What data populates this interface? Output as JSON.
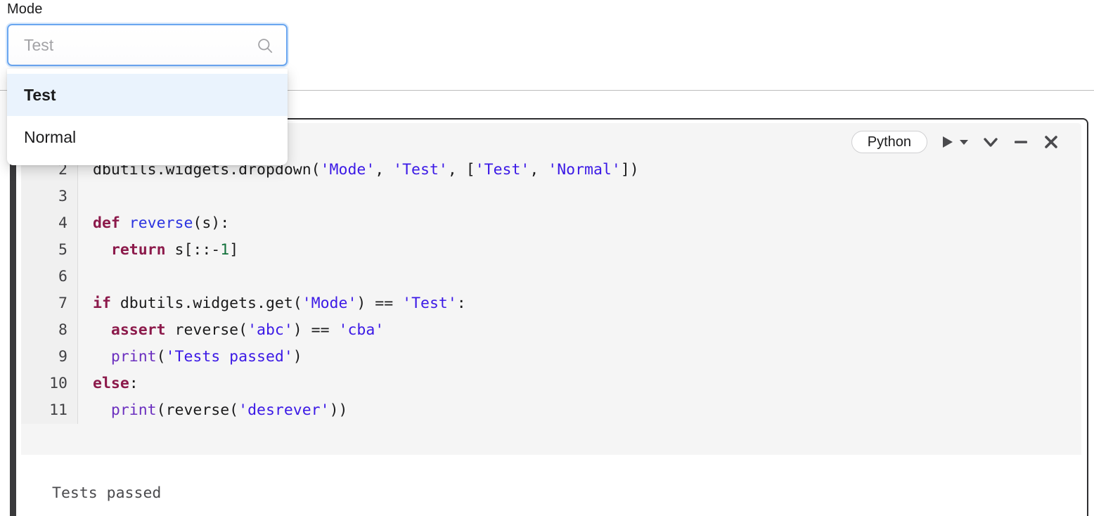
{
  "widget": {
    "label": "Mode",
    "search_placeholder": "Test",
    "search_value": "",
    "search_icon": "search-icon",
    "options": [
      {
        "label": "Test",
        "selected": true
      },
      {
        "label": "Normal",
        "selected": false
      }
    ]
  },
  "cell": {
    "language_badge": "Python",
    "toolbar_icons": [
      {
        "name": "run-icon",
        "glyph": "▶"
      },
      {
        "name": "run-dropdown-caret-icon",
        "glyph": "▼"
      },
      {
        "name": "collapse-chevron-icon",
        "glyph": "⌄"
      },
      {
        "name": "minimize-icon",
        "glyph": "—"
      },
      {
        "name": "close-icon",
        "glyph": "✕"
      }
    ],
    "code_lines": [
      {
        "number": "2",
        "tokens": [
          {
            "text": "dbutils.widgets.dropdown(",
            "cls": "t-pl"
          },
          {
            "text": "'Mode'",
            "cls": "t-str"
          },
          {
            "text": ", ",
            "cls": "t-pl"
          },
          {
            "text": "'Test'",
            "cls": "t-str"
          },
          {
            "text": ", [",
            "cls": "t-pl"
          },
          {
            "text": "'Test'",
            "cls": "t-str"
          },
          {
            "text": ", ",
            "cls": "t-pl"
          },
          {
            "text": "'Normal'",
            "cls": "t-str"
          },
          {
            "text": "])",
            "cls": "t-pl"
          }
        ]
      },
      {
        "number": "3",
        "tokens": [
          {
            "text": "",
            "cls": "t-pl"
          }
        ]
      },
      {
        "number": "4",
        "tokens": [
          {
            "text": "def",
            "cls": "t-kw"
          },
          {
            "text": " ",
            "cls": "t-pl"
          },
          {
            "text": "reverse",
            "cls": "t-fn"
          },
          {
            "text": "(s):",
            "cls": "t-pl"
          }
        ]
      },
      {
        "number": "5",
        "tokens": [
          {
            "text": "  ",
            "cls": "t-pl"
          },
          {
            "text": "return",
            "cls": "t-kw"
          },
          {
            "text": " s[::-",
            "cls": "t-pl"
          },
          {
            "text": "1",
            "cls": "t-num"
          },
          {
            "text": "]",
            "cls": "t-pl"
          }
        ]
      },
      {
        "number": "6",
        "tokens": [
          {
            "text": "",
            "cls": "t-pl"
          }
        ]
      },
      {
        "number": "7",
        "tokens": [
          {
            "text": "if",
            "cls": "t-kw"
          },
          {
            "text": " dbutils.widgets.get(",
            "cls": "t-pl"
          },
          {
            "text": "'Mode'",
            "cls": "t-str"
          },
          {
            "text": ") == ",
            "cls": "t-pl"
          },
          {
            "text": "'Test'",
            "cls": "t-str"
          },
          {
            "text": ":",
            "cls": "t-pl"
          }
        ]
      },
      {
        "number": "8",
        "tokens": [
          {
            "text": "  ",
            "cls": "t-pl"
          },
          {
            "text": "assert",
            "cls": "t-kw"
          },
          {
            "text": " reverse(",
            "cls": "t-pl"
          },
          {
            "text": "'abc'",
            "cls": "t-str"
          },
          {
            "text": ") == ",
            "cls": "t-pl"
          },
          {
            "text": "'cba'",
            "cls": "t-str"
          }
        ]
      },
      {
        "number": "9",
        "tokens": [
          {
            "text": "  ",
            "cls": "t-pl"
          },
          {
            "text": "print",
            "cls": "t-bi"
          },
          {
            "text": "(",
            "cls": "t-pl"
          },
          {
            "text": "'Tests passed'",
            "cls": "t-str"
          },
          {
            "text": ")",
            "cls": "t-pl"
          }
        ]
      },
      {
        "number": "10",
        "tokens": [
          {
            "text": "else",
            "cls": "t-kw"
          },
          {
            "text": ":",
            "cls": "t-pl"
          }
        ]
      },
      {
        "number": "11",
        "tokens": [
          {
            "text": "  ",
            "cls": "t-pl"
          },
          {
            "text": "print",
            "cls": "t-bi"
          },
          {
            "text": "(reverse(",
            "cls": "t-pl"
          },
          {
            "text": "'desrever'",
            "cls": "t-str"
          },
          {
            "text": "))",
            "cls": "t-pl"
          }
        ]
      }
    ],
    "output": "Tests passed"
  },
  "colors": {
    "focus_blue": "#6aa6f0",
    "option_highlight": "#eaf3fd",
    "code_background": "#f5f5f5",
    "gutter_background": "#f0f0f0",
    "cell_border": "#2e2e30",
    "string_token": "#3b19e6",
    "keyword_token": "#8c1a4b",
    "builtin_token": "#6b2fbf",
    "number_token": "#12713b",
    "function_token": "#2b33e0"
  }
}
